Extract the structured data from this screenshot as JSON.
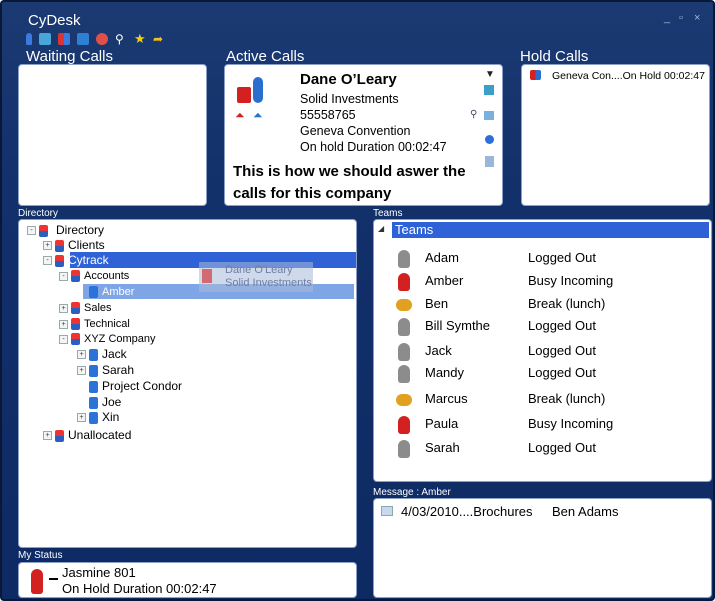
{
  "app": {
    "title": "CyDesk",
    "window_controls": [
      "_",
      "▫",
      "×"
    ]
  },
  "toolbar": {
    "icons": [
      "person-icon",
      "chat-icon",
      "users-icon",
      "transfer-icon",
      "globe-icon",
      "search-icon",
      "star-icon",
      "forward-icon"
    ]
  },
  "sections": {
    "waiting": "Waiting Calls",
    "active": "Active Calls",
    "hold": "Hold Calls",
    "directory": "Directory",
    "teams": "Teams",
    "message": "Message : Amber",
    "status": "My Status"
  },
  "active_call": {
    "name": "Dane O’Leary",
    "company": "Solid Investments",
    "phone": "55558765",
    "group": "Geneva Convention",
    "duration": "On hold Duration 00:02:47",
    "note": "This is how we should aswer the calls for this company"
  },
  "hold_call": {
    "text": "Geneva Con....On Hold 00:02:47"
  },
  "drag_ghost": {
    "name": "Dane O'Leary",
    "company": "Solid Investments"
  },
  "directory": {
    "items": [
      {
        "label": "Directory",
        "exp": "-"
      },
      {
        "label": "Clients",
        "exp": "+"
      },
      {
        "label": "Cytrack",
        "exp": "-"
      },
      {
        "label": "Accounts",
        "exp": "-"
      },
      {
        "label": "Amber",
        "exp": ""
      },
      {
        "label": "Sales",
        "exp": "+"
      },
      {
        "label": "Technical",
        "exp": "+"
      },
      {
        "label": "XYZ Company",
        "exp": "-"
      },
      {
        "label": "Jack",
        "exp": "+"
      },
      {
        "label": "Sarah",
        "exp": "+"
      },
      {
        "label": "Project Condor",
        "exp": ""
      },
      {
        "label": "Joe",
        "exp": ""
      },
      {
        "label": "Xin",
        "exp": "+"
      },
      {
        "label": "Unallocated",
        "exp": "+"
      }
    ]
  },
  "teams": {
    "header": "Teams",
    "members": [
      {
        "name": "Adam",
        "status": "Logged Out"
      },
      {
        "name": "Amber",
        "status": "Busy Incoming"
      },
      {
        "name": "Ben",
        "status": "Break (lunch)"
      },
      {
        "name": "Bill Symthe",
        "status": "Logged Out"
      },
      {
        "name": "Jack",
        "status": "Logged Out"
      },
      {
        "name": "Mandy",
        "status": "Logged Out"
      },
      {
        "name": "Marcus",
        "status": "Break (lunch)"
      },
      {
        "name": "Paula",
        "status": "Busy Incoming"
      },
      {
        "name": "Sarah",
        "status": "Logged Out"
      }
    ]
  },
  "message": {
    "date_subject": "4/03/2010....Brochures",
    "from": "Ben Adams"
  },
  "my_status": {
    "line1": "Jasmine 801",
    "line2": "On Hold Duration 00:02:47"
  },
  "colors": {
    "background": "#12306a",
    "selection": "#2e62d6",
    "accent_red": "#d32020"
  }
}
